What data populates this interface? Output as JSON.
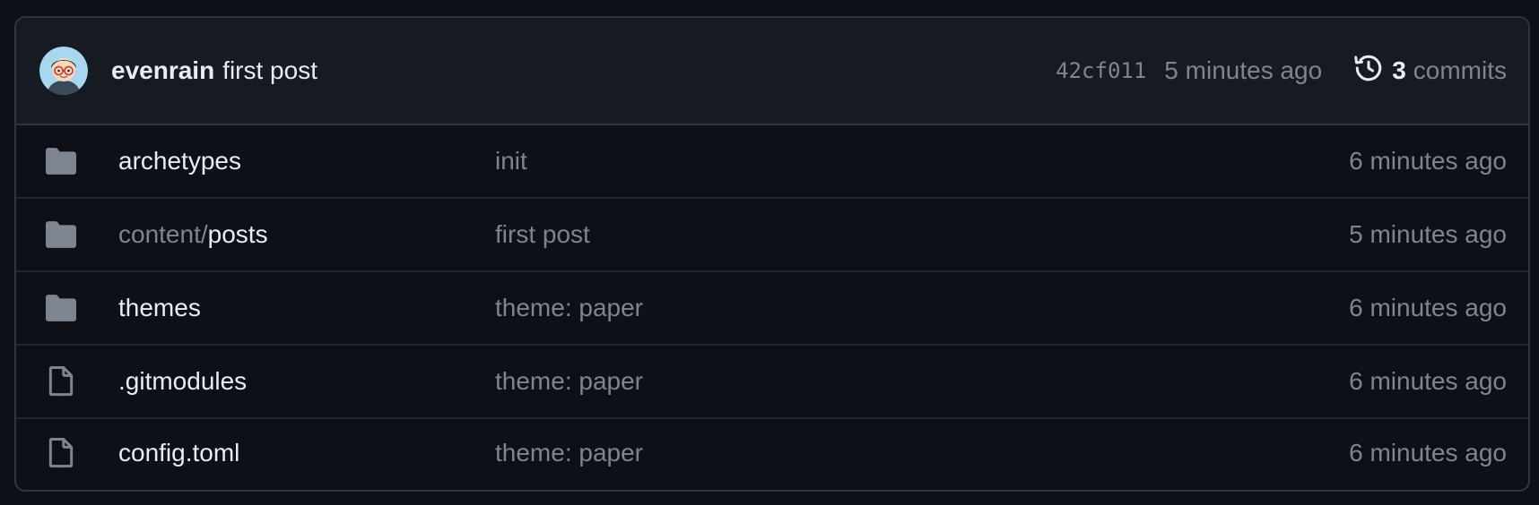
{
  "latest_commit": {
    "author": "evenrain",
    "message": "first post",
    "sha": "42cf011",
    "time": "5 minutes ago",
    "commit_count": "3",
    "commits_label": "commits"
  },
  "files": [
    {
      "type": "folder",
      "prefix": "",
      "name": "archetypes",
      "message": "init",
      "time": "6 minutes ago"
    },
    {
      "type": "folder",
      "prefix": "content/",
      "name": "posts",
      "message": "first post",
      "time": "5 minutes ago"
    },
    {
      "type": "folder",
      "prefix": "",
      "name": "themes",
      "message": "theme: paper",
      "time": "6 minutes ago"
    },
    {
      "type": "file",
      "prefix": "",
      "name": ".gitmodules",
      "message": "theme: paper",
      "time": "6 minutes ago"
    },
    {
      "type": "file",
      "prefix": "",
      "name": "config.toml",
      "message": "theme: paper",
      "time": "6 minutes ago"
    }
  ],
  "colors": {
    "background": "#0d1117",
    "header": "#161b22",
    "text": "#e6edf3",
    "muted": "#7d8590",
    "border": "#30363d"
  }
}
